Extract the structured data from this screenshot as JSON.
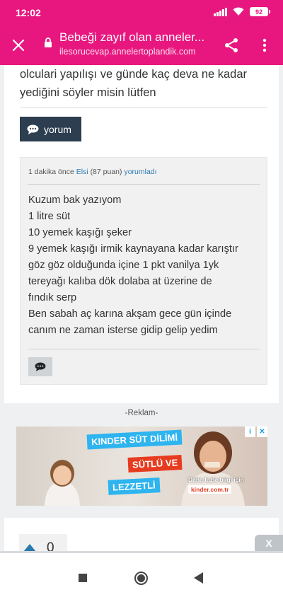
{
  "status_bar": {
    "time": "12:02",
    "battery": "92"
  },
  "browser": {
    "page_title": "Bebeği zayıf olan anneler...",
    "url": "ilesorucevap.annelertoplandik.com"
  },
  "question": {
    "lines": [
      "olculari yapılışı ve günde kaç deva ne kadar",
      "yediğini söyler misin lütfen"
    ],
    "comment_button_label": "yorum"
  },
  "answer": {
    "meta": {
      "time": "1 dakika önce",
      "author": "Elsi",
      "points": "(87 puan)",
      "action": "yorumladı"
    },
    "body_lines": [
      "Kuzum bak yazıyom",
      "1 litre süt",
      "10 yemek kaşığı şeker",
      "9 yemek kaşığı irmik kaynayana kadar karıştır",
      "göz göz olduğunda içine 1 pkt vanilya 1yk",
      "tereyağı kalıba dök dolaba at üzerine de",
      "fındık serp",
      "Ben sabah aç karına akşam gece gün içinde",
      "canım ne zaman isterse gidip gelip yedim"
    ]
  },
  "ad": {
    "label": "-Reklam-",
    "tag1": "KINDER SÜT DİLİMİ",
    "tag2": "SÜTLÜ VE",
    "tag3": "LEZZETLİ",
    "info_text": "Daha fazla bilgi için",
    "brand": "kinder.com.tr",
    "info_icon": "i",
    "close_icon": "✕",
    "close_overlay": "X"
  },
  "next_answer": {
    "vote_count": "0"
  },
  "colors": {
    "header": "#e8177f",
    "comment_button": "#2c3e50",
    "link": "#2a7ab0"
  }
}
